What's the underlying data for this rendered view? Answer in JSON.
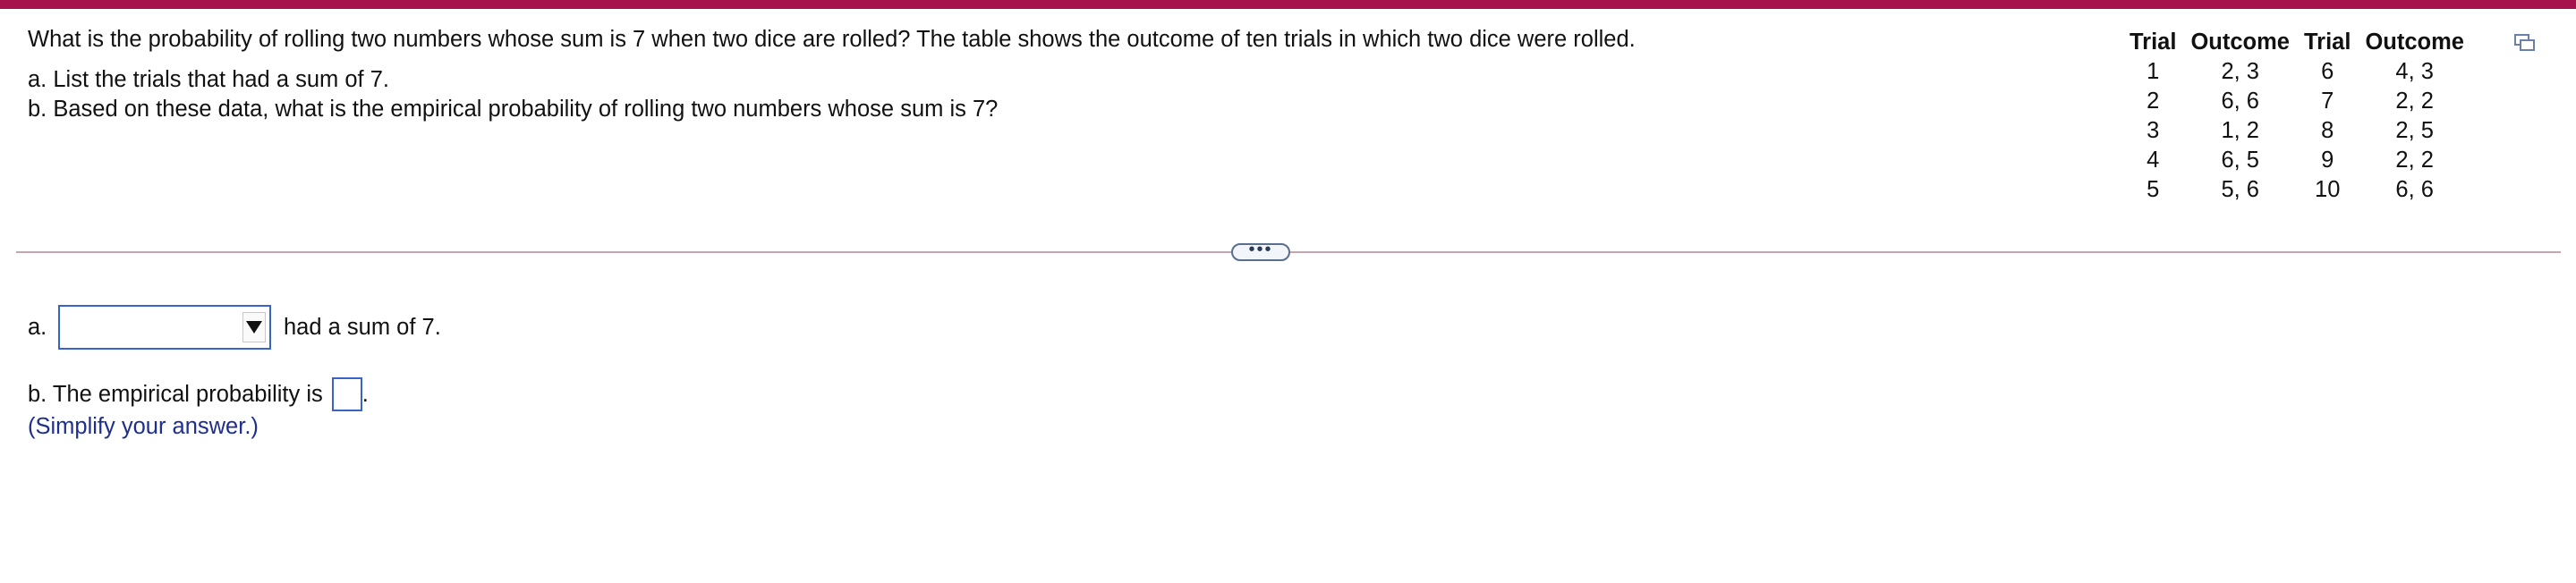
{
  "question": {
    "intro": "What is the probability of rolling two numbers whose sum is 7 when two dice are rolled? The table shows the outcome of ten trials in which two dice were rolled.",
    "part_a": "a. List the trials that had a sum of 7.",
    "part_b": "b. Based on these data, what is the empirical probability of rolling two numbers whose sum is 7?"
  },
  "table": {
    "headers": [
      "Trial",
      "Outcome",
      "Trial",
      "Outcome"
    ],
    "rows": [
      [
        "1",
        "2, 3",
        "6",
        "4, 3"
      ],
      [
        "2",
        "6, 6",
        "7",
        "2, 2"
      ],
      [
        "3",
        "1, 2",
        "8",
        "2, 5"
      ],
      [
        "4",
        "6, 5",
        "9",
        "2, 2"
      ],
      [
        "5",
        "5, 6",
        "10",
        "6, 6"
      ]
    ]
  },
  "expander": {
    "label": "•••"
  },
  "answer_a": {
    "label": "a.",
    "dropdown_value": "",
    "after_text": "had a sum of 7."
  },
  "answer_b": {
    "prefix": "b. The empirical probability is",
    "value": "",
    "suffix": "."
  },
  "hint": "(Simplify your answer.)",
  "icons": {
    "copy": "copy-icon",
    "dropdown": "triangle-down-icon"
  },
  "colors": {
    "top_bar": "#a6124b",
    "input_border": "#3a63c8",
    "hint_text": "#1e2f8f"
  }
}
